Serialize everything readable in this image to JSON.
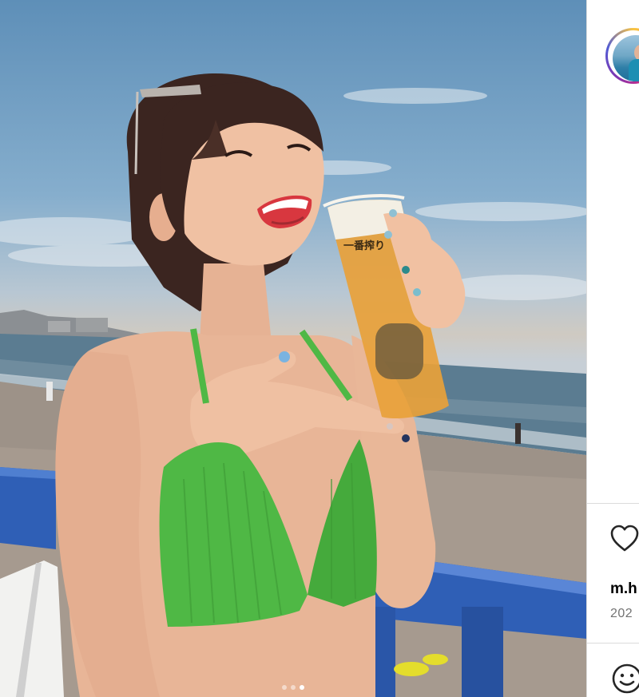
{
  "post": {
    "username": "m.h",
    "date": "202",
    "photo_subject": "woman-holding-beer-glass-on-beach",
    "cup_print": "一番搾り"
  },
  "carousel": {
    "total": 3,
    "active_index": 2
  },
  "icons": {
    "like": "heart-icon",
    "emoji": "smiley-icon",
    "avatar": "profile-avatar"
  },
  "colors": {
    "divider": "#dbdbdb",
    "username": "#000000",
    "date": "#737373",
    "bikini": "#4fb845",
    "railing": "#2f5fb6"
  }
}
